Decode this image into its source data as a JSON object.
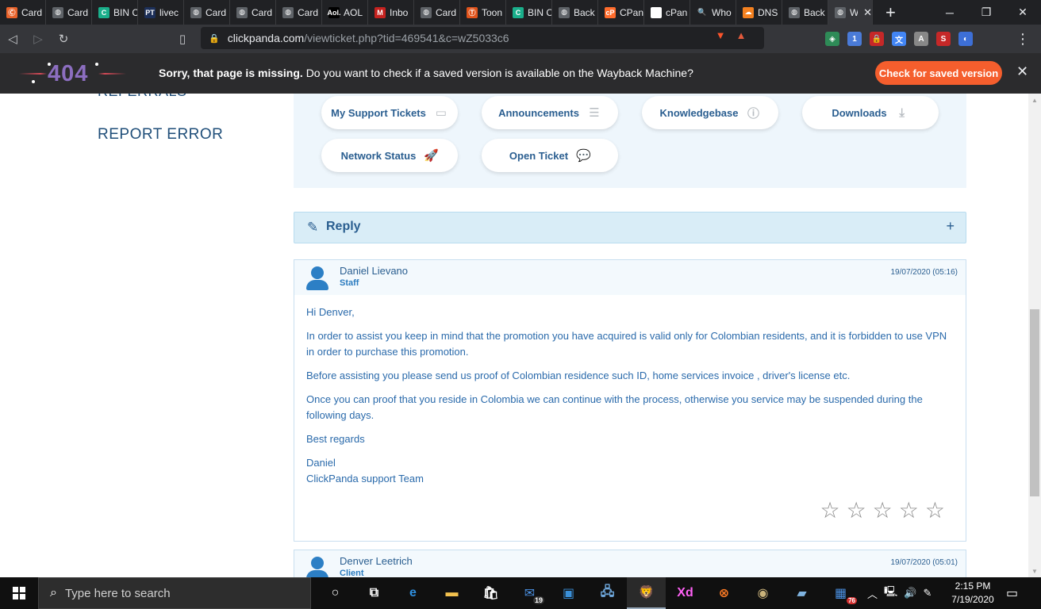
{
  "tabs": [
    {
      "title": "Card",
      "fav": "Ⓒ",
      "color": "#e8622a"
    },
    {
      "title": "Card",
      "fav": "◍",
      "color": "#5f6368"
    },
    {
      "title": "BIN C",
      "fav": "C",
      "color": "#1aaf8b"
    },
    {
      "title": "livec",
      "fav": "PT",
      "color": "#1c2f59"
    },
    {
      "title": "Card",
      "fav": "◍",
      "color": "#5f6368"
    },
    {
      "title": "Card",
      "fav": "◍",
      "color": "#5f6368"
    },
    {
      "title": "Card",
      "fav": "◍",
      "color": "#5f6368"
    },
    {
      "title": "AOL",
      "fav": "Aol.",
      "color": "#000000"
    },
    {
      "title": "Inbo",
      "fav": "M",
      "color": "#c5221f"
    },
    {
      "title": "Card",
      "fav": "◍",
      "color": "#5f6368"
    },
    {
      "title": "Toon",
      "fav": "Ⓣ",
      "color": "#e0531b"
    },
    {
      "title": "BIN C",
      "fav": "C",
      "color": "#1aaf8b"
    },
    {
      "title": "Back",
      "fav": "◍",
      "color": "#5f6368"
    },
    {
      "title": "CPan",
      "fav": "cP",
      "color": "#ff6c2c"
    },
    {
      "title": "cPan",
      "fav": "",
      "color": "#ffffff"
    },
    {
      "title": "Who",
      "fav": "🔍",
      "color": "#202124"
    },
    {
      "title": "DNS",
      "fav": "☁",
      "color": "#f48120"
    },
    {
      "title": "Back",
      "fav": "◍",
      "color": "#5f6368"
    }
  ],
  "active_tab": {
    "title": "W",
    "fav": "◍",
    "color": "#5f6368"
  },
  "browser": {
    "host": "clickpanda.com",
    "path": "/viewticket.php?tid=469541&c=wZ5033c6",
    "lock_icon": "lock-icon"
  },
  "wayback": {
    "logo_text": "404",
    "message_bold": "Sorry, that page is missing.",
    "message": "Do you want to check if a saved version is available on the Wayback Machine?",
    "button": "Check for saved version",
    "accent": "#f55e2d"
  },
  "sidebar": {
    "partial_item": "REFERRALS",
    "item": "REPORT ERROR"
  },
  "nav_pills": [
    {
      "label": "My Support Tickets",
      "icon": "ticket-icon",
      "glyph": "▭"
    },
    {
      "label": "Announcements",
      "icon": "list-icon",
      "glyph": "☰"
    },
    {
      "label": "Knowledgebase",
      "icon": "info-icon",
      "glyph": "ⓘ"
    },
    {
      "label": "Downloads",
      "icon": "download-icon",
      "glyph": "⤓"
    },
    {
      "label": "Network Status",
      "icon": "rocket-icon",
      "glyph": "🚀"
    },
    {
      "label": "Open Ticket",
      "icon": "comments-icon",
      "glyph": "💬"
    }
  ],
  "reply": {
    "label": "Reply",
    "toggle": "+"
  },
  "messages": [
    {
      "author": "Daniel Lievano",
      "role": "Staff",
      "date": "19/07/2020 (05:16)",
      "paragraphs": [
        "Hi Denver,",
        "In order to assist you keep in mind that the promotion you have acquired is valid only for Colombian residents, and it is forbidden to use VPN in order to purchase this promotion.",
        "Before assisting you please send us proof of Colombian residence such ID, home services invoice , driver's license etc.",
        "Once you can proof that you reside in Colombia we can continue with the process, otherwise you service may be suspended during the following days.",
        "Best regards"
      ],
      "signature_name": "Daniel",
      "signature_team": "ClickPanda support Team",
      "rating_stars": 5
    },
    {
      "author": "Denver Leetrich",
      "role": "Client",
      "date": "19/07/2020 (05:01)"
    }
  ],
  "taskbar": {
    "search_placeholder": "Type here to search",
    "mail_badge": "19",
    "tray_badge": "76",
    "time": "2:15 PM",
    "date": "7/19/2020"
  }
}
